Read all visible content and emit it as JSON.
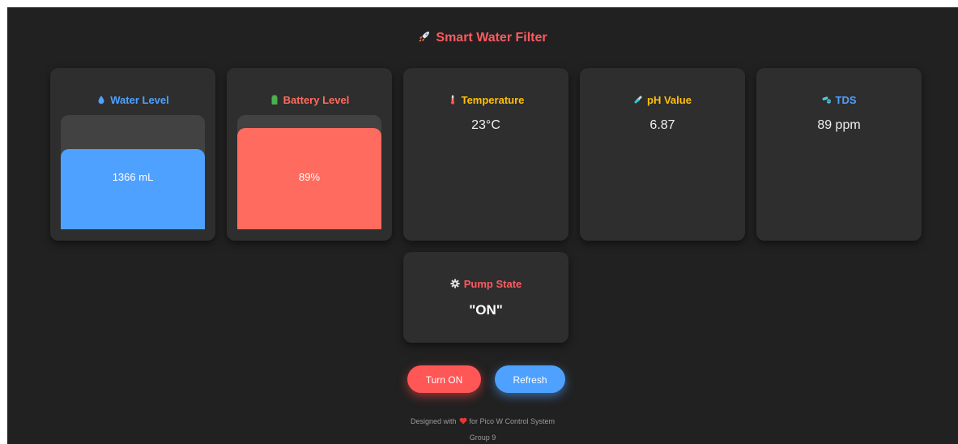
{
  "header": {
    "title": "Smart Water Filter",
    "icon": "rocket-icon"
  },
  "cards": {
    "water": {
      "label": "Water Level",
      "value": "1366 mL",
      "fill_percent": 70,
      "color": "#4ea1ff",
      "icon": "water-drop-icon"
    },
    "battery": {
      "label": "Battery Level",
      "value": "89%",
      "fill_percent": 89,
      "color": "#ff6b5e",
      "icon": "battery-icon"
    },
    "temperature": {
      "label": "Temperature",
      "value": "23°C",
      "color": "#ffc107",
      "icon": "thermometer-icon"
    },
    "ph": {
      "label": "pH Value",
      "value": "6.87",
      "color": "#ffc107",
      "icon": "test-tube-icon"
    },
    "tds": {
      "label": "TDS",
      "value": "89 ppm",
      "color": "#4ea1ff",
      "icon": "pills-icon"
    },
    "pump": {
      "label": "Pump State",
      "value": "\"ON\"",
      "color": "#ff5a5f",
      "icon": "gear-icon"
    }
  },
  "buttons": {
    "turn_on": "Turn ON",
    "refresh": "Refresh"
  },
  "footer": {
    "designed_prefix": "Designed with",
    "designed_suffix": "for Pico W Control System",
    "group": "Group 9"
  }
}
